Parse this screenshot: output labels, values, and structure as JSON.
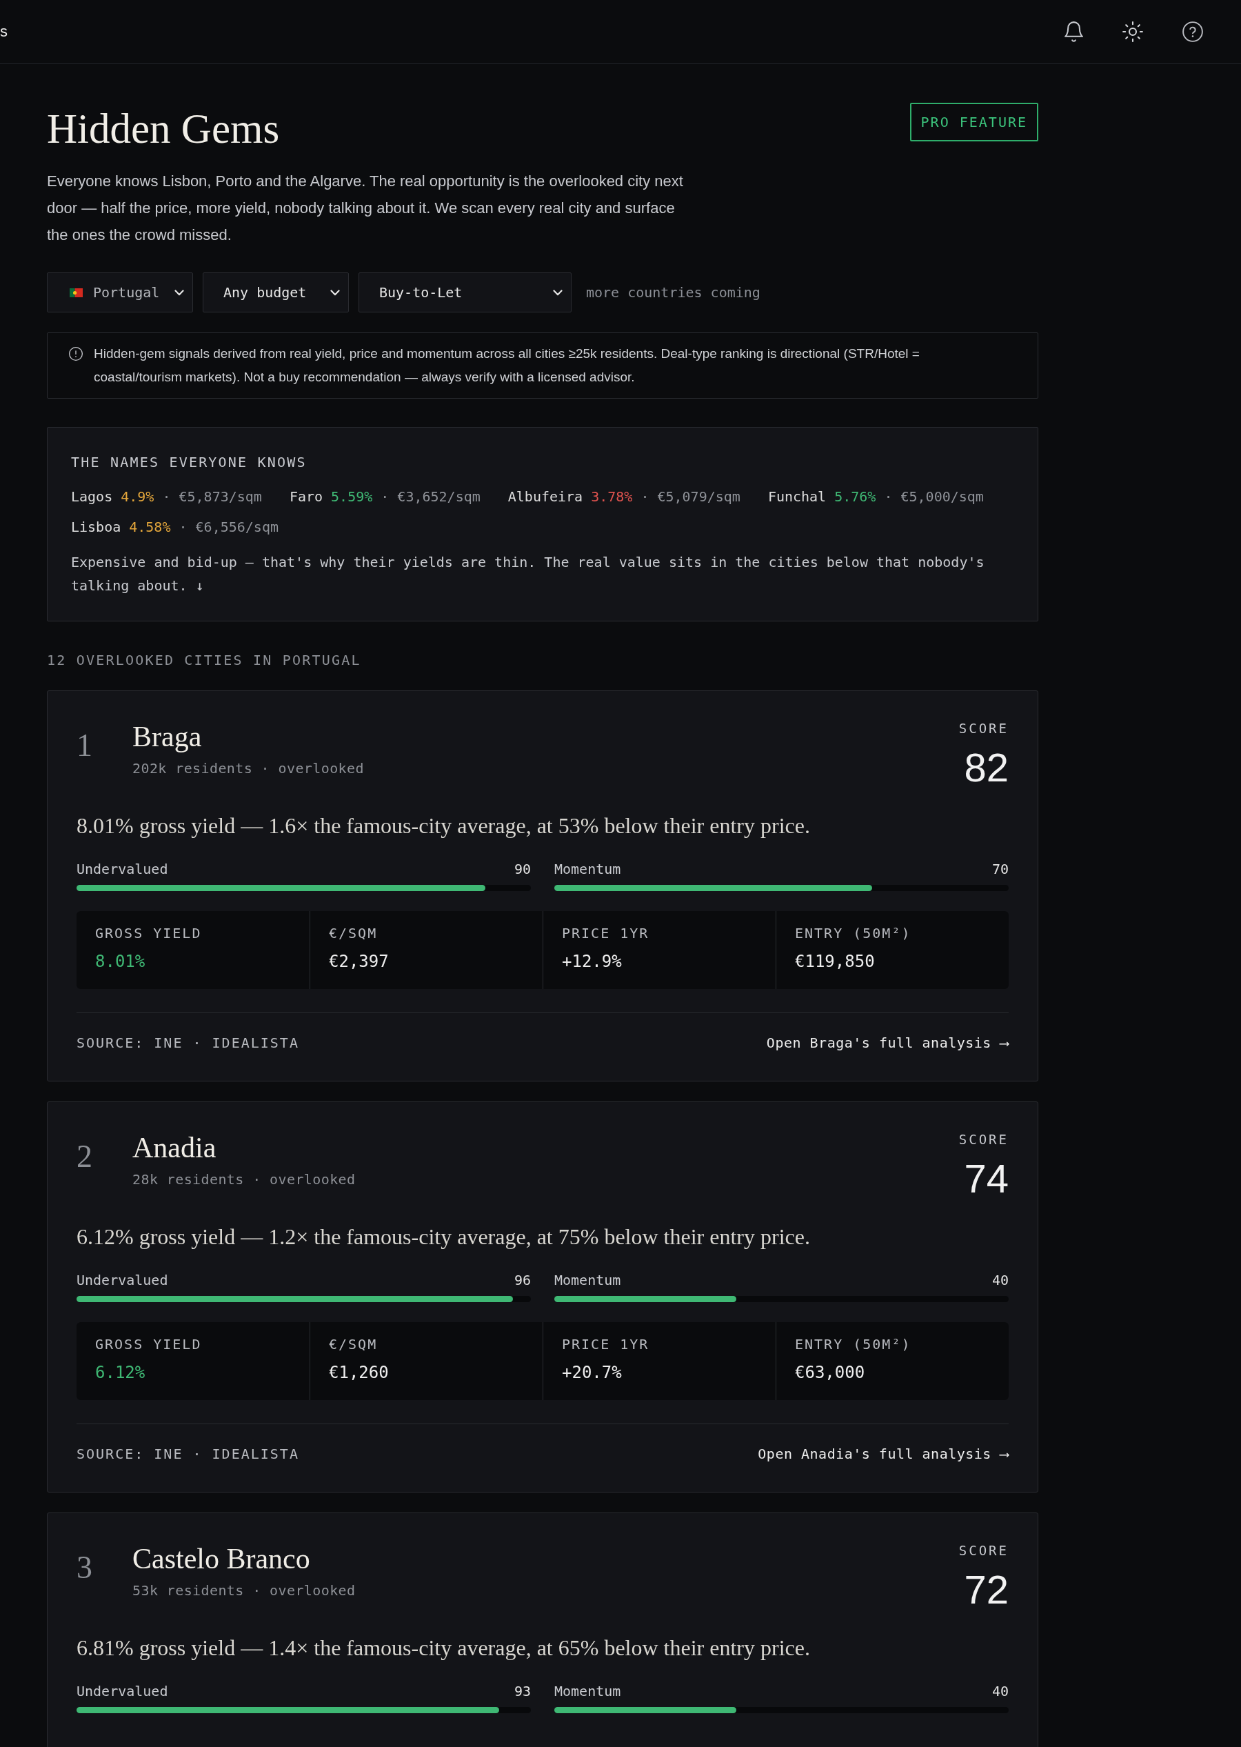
{
  "topbar": {
    "title_fragment": "s"
  },
  "header": {
    "title": "Hidden Gems",
    "badge": "PRO FEATURE",
    "intro": "Everyone knows Lisbon, Porto and the Algarve. The real opportunity is the overlooked city next door — half the price, more yield, nobody talking about it. We scan every real city and surface the ones the crowd missed."
  },
  "filters": {
    "dropdowns": [
      {
        "kind": "country",
        "value": "Portugal"
      },
      {
        "kind": "budget",
        "value": "Any budget"
      },
      {
        "kind": "deal_type",
        "value": "Buy-to-Let"
      }
    ],
    "note": "more countries coming"
  },
  "notice": "Hidden-gem signals derived from real yield, price and momentum across all cities ≥25k residents. Deal-type ranking is directional (STR/Hotel = coastal/tourism markets). Not a buy recommendation — always verify with a licensed advisor.",
  "famous": {
    "heading": "THE NAMES EVERYONE KNOWS",
    "cities": [
      {
        "name": "Lagos",
        "yield": "4.9%",
        "color": "#e3a63b",
        "price": "· €5,873/sqm"
      },
      {
        "name": "Faro",
        "yield": "5.59%",
        "color": "#3fb874",
        "price": "· €3,652/sqm"
      },
      {
        "name": "Albufeira",
        "yield": "3.78%",
        "color": "#e0534f",
        "price": "· €5,079/sqm"
      },
      {
        "name": "Funchal",
        "yield": "5.76%",
        "color": "#3fb874",
        "price": "· €5,000/sqm"
      },
      {
        "name": "Lisboa",
        "yield": "4.58%",
        "color": "#e3a63b",
        "price": "· €6,556/sqm"
      }
    ],
    "note": "Expensive and bid-up — that's why their yields are thin. The real value sits in the cities below that nobody's talking about. ↓"
  },
  "list_heading": "12 OVERLOOKED CITIES IN PORTUGAL",
  "cards": [
    {
      "rank": "1",
      "name": "Braga",
      "subtitle": "202k residents · overlooked",
      "score_label": "SCORE",
      "score": "82",
      "summary": "8.01% gross yield — 1.6× the famous-city average, at 53% below their entry price.",
      "meters": [
        {
          "label": "Undervalued",
          "reading": "90",
          "level": 0.9
        },
        {
          "label": "Momentum",
          "reading": "70",
          "level": 0.7
        }
      ],
      "stats": [
        {
          "label": "GROSS YIELD",
          "value": "8.01%",
          "kind": "accent"
        },
        {
          "label": "€/SQM",
          "value": "€2,397",
          "kind": "plain"
        },
        {
          "label": "PRICE 1YR",
          "value": "+12.9%",
          "kind": "plain"
        },
        {
          "label": "ENTRY (50M²)",
          "value": "€119,850",
          "kind": "plain"
        }
      ],
      "source": "SOURCE: INE · IDEALISTA",
      "link": "Open Braga's full analysis ⟶"
    },
    {
      "rank": "2",
      "name": "Anadia",
      "subtitle": "28k residents · overlooked",
      "score_label": "SCORE",
      "score": "74",
      "summary": "6.12% gross yield — 1.2× the famous-city average, at 75% below their entry price.",
      "meters": [
        {
          "label": "Undervalued",
          "reading": "96",
          "level": 0.96
        },
        {
          "label": "Momentum",
          "reading": "40",
          "level": 0.4
        }
      ],
      "stats": [
        {
          "label": "GROSS YIELD",
          "value": "6.12%",
          "kind": "accent"
        },
        {
          "label": "€/SQM",
          "value": "€1,260",
          "kind": "plain"
        },
        {
          "label": "PRICE 1YR",
          "value": "+20.7%",
          "kind": "plain"
        },
        {
          "label": "ENTRY (50M²)",
          "value": "€63,000",
          "kind": "plain"
        }
      ],
      "source": "SOURCE: INE · IDEALISTA",
      "link": "Open Anadia's full analysis ⟶"
    },
    {
      "rank": "3",
      "name": "Castelo Branco",
      "subtitle": "53k residents · overlooked",
      "score_label": "SCORE",
      "score": "72",
      "summary": "6.81% gross yield — 1.4× the famous-city average, at 65% below their entry price.",
      "meters": [
        {
          "label": "Undervalued",
          "reading": "93",
          "level": 0.93
        },
        {
          "label": "Momentum",
          "reading": "40",
          "level": 0.4
        }
      ]
    }
  ]
}
